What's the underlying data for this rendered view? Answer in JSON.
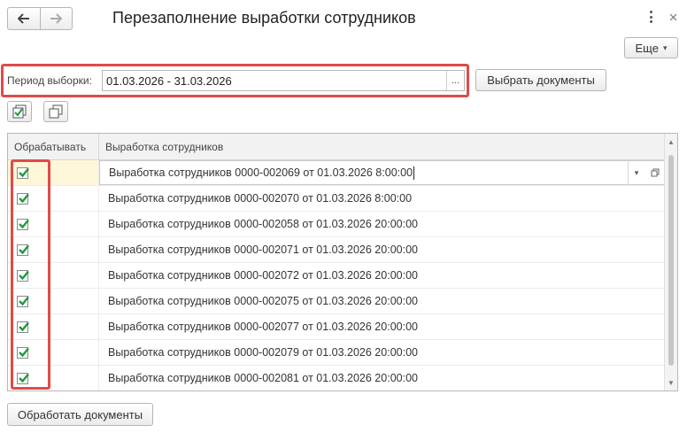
{
  "window": {
    "title": "Перезаполнение выработки сотрудников",
    "back_icon": "arrow-left-icon",
    "forward_icon": "arrow-right-icon",
    "close_icon": "close-icon",
    "menu_icon": "more-vertical-icon"
  },
  "toolbar": {
    "more_label": "Еще",
    "more_suffix": "▾"
  },
  "filter": {
    "period_label": "Период выборки:",
    "period_value": "01.03.2026 - 31.03.2026",
    "select_button_label": "Выбрать документы",
    "dots": "..."
  },
  "list_commands": {
    "check_all_icon": "check-all-icon",
    "copy_icon": "copy-icon"
  },
  "table": {
    "columns": [
      "Обрабатывать",
      "Выработка сотрудников"
    ],
    "rows": [
      {
        "checked": true,
        "document": "Выработка сотрудников 0000-002069 от 01.03.2026 8:00:00",
        "selected": true
      },
      {
        "checked": true,
        "document": "Выработка сотрудников 0000-002070 от 01.03.2026 8:00:00"
      },
      {
        "checked": true,
        "document": "Выработка сотрудников 0000-002058 от 01.03.2026 20:00:00"
      },
      {
        "checked": true,
        "document": "Выработка сотрудников 0000-002071 от 01.03.2026 20:00:00"
      },
      {
        "checked": true,
        "document": "Выработка сотрудников 0000-002072 от 01.03.2026 20:00:00"
      },
      {
        "checked": true,
        "document": "Выработка сотрудников 0000-002075 от 01.03.2026 20:00:00"
      },
      {
        "checked": true,
        "document": "Выработка сотрудников 0000-002077 от 01.03.2026 20:00:00"
      },
      {
        "checked": true,
        "document": "Выработка сотрудников 0000-002079 от 01.03.2026 20:00:00"
      },
      {
        "checked": true,
        "document": "Выработка сотрудников 0000-002081 от 01.03.2026 20:00:00"
      }
    ]
  },
  "footer": {
    "process_button_label": "Обработать документы"
  },
  "colors": {
    "highlight": "#e04a4a",
    "check": "#1d9a3c",
    "selected_cell": "#fef6d8"
  }
}
